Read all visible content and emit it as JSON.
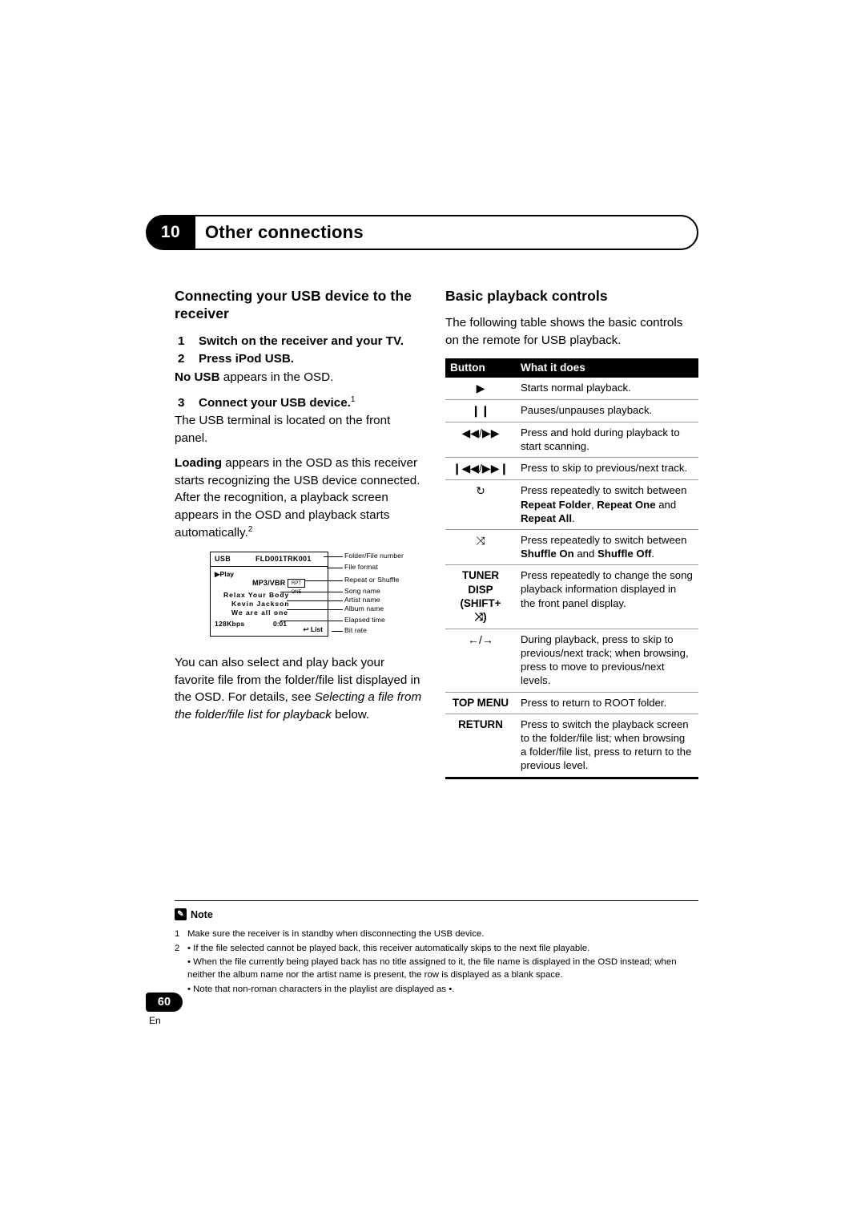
{
  "header": {
    "chapter_number": "10",
    "chapter_title": "Other connections"
  },
  "left_column": {
    "section_title": "Connecting your USB device to the receiver",
    "steps": [
      {
        "num": "1",
        "title": "Switch on the receiver and your TV."
      },
      {
        "num": "2",
        "title": "Press iPod USB."
      },
      {
        "num": "3",
        "title": "Connect your USB device."
      }
    ],
    "step2_note_bold": "No USB",
    "step2_note_rest": " appears in the OSD.",
    "step3_superscript": "1",
    "step3_note": "The USB terminal is located on the front panel.",
    "paragraph1_bold": "Loading",
    "paragraph1_rest": " appears in the OSD as this receiver starts recognizing the USB device connected. After the recognition, a playback screen appears in the OSD and playback starts automatically.",
    "paragraph1_superscript": "2",
    "figure": {
      "osd": {
        "usb": "USB",
        "folder_file": "FLD001TRK001",
        "play": "Play",
        "format": "MP3/VBR",
        "repeat_box": "RPT ONE",
        "song": "Relax Your Body",
        "artist": "Kevin Jackson",
        "album": "We are all one",
        "bitrate": "128Kbps",
        "time": "0:01",
        "list": "List"
      },
      "callouts": [
        "Folder/File number",
        "File format",
        "Repeat or Shuffle",
        "Song name",
        "Artist name",
        "Album name",
        "Elapsed time",
        "Bit rate"
      ]
    },
    "paragraph2_part1": "You can also select and play back your favorite file from the folder/file list displayed in the OSD. For details, see ",
    "paragraph2_italic": "Selecting a file from the folder/file list for playback",
    "paragraph2_part2": " below."
  },
  "right_column": {
    "section_title": "Basic playback controls",
    "intro": "The following table shows the basic controls on the remote for USB playback.",
    "table": {
      "headers": [
        "Button",
        "What it does"
      ],
      "rows": [
        {
          "button": "▶",
          "button_type": "sym",
          "desc": "Starts normal playback."
        },
        {
          "button": "❙❙",
          "button_type": "sym",
          "desc": "Pauses/unpauses playback."
        },
        {
          "button": "◀◀/▶▶",
          "button_type": "sym",
          "desc": "Press and hold during playback to start scanning."
        },
        {
          "button": "❙◀◀/▶▶❙",
          "button_type": "sym",
          "desc": "Press to skip to previous/next track."
        },
        {
          "button": "↻",
          "button_type": "sym",
          "desc_pre": "Press repeatedly to switch between ",
          "desc_bold1": "Repeat Folder",
          "desc_mid1": ", ",
          "desc_bold2": "Repeat One",
          "desc_mid2": " and ",
          "desc_bold3": "Repeat All",
          "desc_post": "."
        },
        {
          "button": "⤨",
          "button_type": "sym",
          "desc_pre": "Press repeatedly to switch between ",
          "desc_bold1": "Shuffle On",
          "desc_mid1": " and ",
          "desc_bold2": "Shuffle Off",
          "desc_post": "."
        },
        {
          "button": "TUNER\nDISP\n(SHIFT+\n⤨)",
          "button_type": "text",
          "desc": "Press repeatedly to change the song playback information displayed in the front panel display."
        },
        {
          "button": "←/→",
          "button_type": "sym",
          "desc": "During playback, press to skip to previous/next track; when browsing, press to move to previous/next levels."
        },
        {
          "button": "TOP MENU",
          "button_type": "text",
          "desc": "Press to return to ROOT folder."
        },
        {
          "button": "RETURN",
          "button_type": "text",
          "desc": "Press to switch the playback screen to the folder/file list; when browsing a folder/file list, press to return to the previous level."
        }
      ]
    }
  },
  "notes": {
    "label": "Note",
    "badge": "✎",
    "items": [
      {
        "num": "1",
        "text": "Make sure the receiver is in standby when disconnecting the USB device."
      },
      {
        "num": "2",
        "text": "• If the file selected cannot be played back, this receiver automatically skips to the next file playable."
      },
      {
        "num": "",
        "text": "• When the file currently being played back has no title assigned to it, the file name is displayed in the OSD instead; when neither the album name nor the artist name is present, the row is displayed as a blank space."
      },
      {
        "num": "",
        "text": "• Note that non-roman characters in the playlist are displayed as •."
      }
    ]
  },
  "footer": {
    "page_number": "60",
    "language": "En"
  }
}
